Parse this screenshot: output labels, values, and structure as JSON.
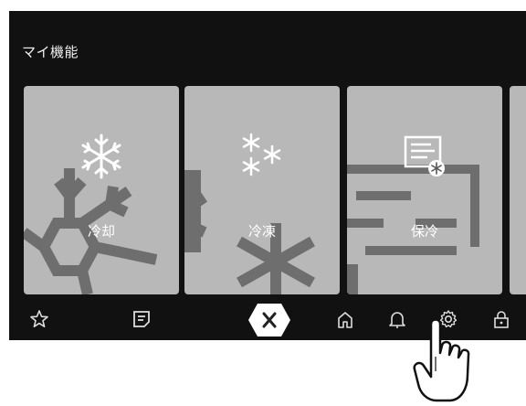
{
  "header": {
    "title": "マイ機能"
  },
  "cards": [
    {
      "label": "冷却",
      "icon": "snowflake-icon"
    },
    {
      "label": "冷凍",
      "icon": "snowflakes-icon"
    },
    {
      "label": "保冷",
      "icon": "document-snowflake-icon"
    }
  ],
  "bottom_nav": [
    {
      "icon": "star-icon"
    },
    {
      "icon": "note-icon"
    },
    {
      "icon": "close-icon"
    },
    {
      "icon": "home-icon"
    },
    {
      "icon": "bell-icon"
    },
    {
      "icon": "gear-icon"
    },
    {
      "icon": "lock-icon"
    }
  ],
  "colors": {
    "background": "#111111",
    "card": "#b8b8b8",
    "card_pattern": "#6e6e6e",
    "icon": "#ffffff",
    "nav_icon": "#dddddd"
  }
}
